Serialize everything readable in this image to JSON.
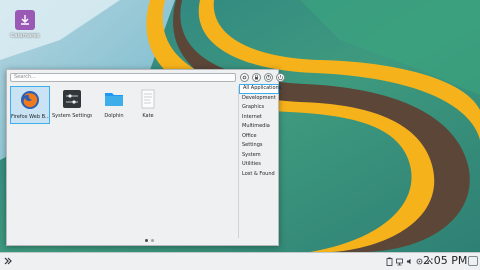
{
  "desktop": {
    "icon_label": "Calamares"
  },
  "launcher": {
    "search_placeholder": "Search...",
    "apps": [
      {
        "label": "Firefox Web B...",
        "icon": "firefox-icon"
      },
      {
        "label": "System Settings",
        "icon": "system-settings-icon"
      },
      {
        "label": "Dolphin",
        "icon": "folder-icon"
      },
      {
        "label": "Kate",
        "icon": "text-editor-icon"
      }
    ],
    "categories": [
      "All Applications",
      "Development",
      "Graphics",
      "Internet",
      "Multimedia",
      "Office",
      "Settings",
      "System",
      "Utilities",
      "Lost & Found"
    ],
    "selected_category": "All Applications",
    "page": 1,
    "page_count": 2
  },
  "taskbar": {
    "clock": "2:05 PM",
    "tray_icons": [
      "clipboard-icon",
      "network-icon",
      "volume-icon",
      "notifications-icon",
      "tray-expand-icon"
    ]
  },
  "colors": {
    "accent": "#3daee9",
    "panel_bg": "#eff0f1",
    "wallpaper_teal": "#3f8e7d",
    "ribbon_yellow": "#f6b21b",
    "ribbon_brown": "#5b4638"
  }
}
